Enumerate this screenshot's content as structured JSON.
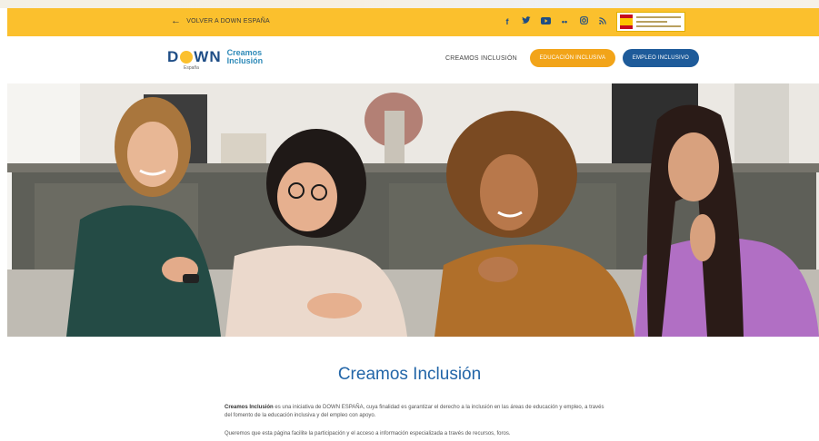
{
  "topbar": {
    "back_label": "VOLVER A DOWN ESPAÑA",
    "back_icon": "arrow-left-icon",
    "socials": [
      {
        "name": "facebook-icon",
        "glyph": "f"
      },
      {
        "name": "twitter-icon",
        "glyph": "🐦"
      },
      {
        "name": "youtube-icon",
        "glyph": "▶"
      },
      {
        "name": "flickr-icon",
        "glyph": "••"
      },
      {
        "name": "instagram-icon",
        "glyph": "◎"
      },
      {
        "name": "rss-icon",
        "glyph": "≋"
      }
    ],
    "bg_color": "#fbc02d"
  },
  "header": {
    "logo_word": "DOWN",
    "logo_sub": "España",
    "logo_creamos": "Creamos",
    "logo_inclusion": "Inclusión",
    "nav_link": "CREAMOS INCLUSIÓN",
    "btn_education": "EDUCACIÓN INCLUSIVA",
    "btn_employment": "EMPLEO INCLUSIVO",
    "accent_orange": "#f2a419",
    "accent_blue": "#1e5b9a"
  },
  "main": {
    "title": "Creamos Inclusión",
    "intro_bold": "Creamos Inclusión",
    "intro_rest": " es una iniciativa de DOWN ESPAÑA, cuya finalidad es garantizar el derecho a la inclusión en las áreas de educación y empleo, a través del fomento de la educación inclusiva y del empleo con apoyo.",
    "para2": "Queremos que esta página facilite la participación y el acceso a información especializada a través de recursos, foros."
  }
}
